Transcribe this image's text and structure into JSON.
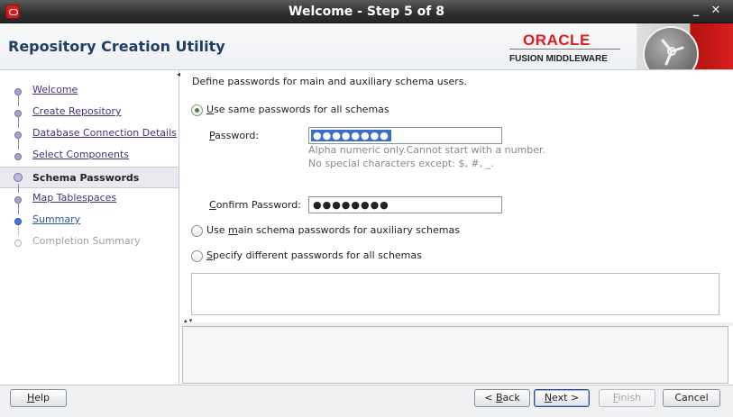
{
  "window": {
    "title": "Welcome - Step 5 of 8",
    "minimize_glyph": "_",
    "close_glyph": "✕"
  },
  "header": {
    "app_title": "Repository Creation Utility",
    "brand_name": "ORACLE",
    "brand_sub": "FUSION MIDDLEWARE",
    "brand_color": "#e01d1d"
  },
  "sidebar": {
    "steps": [
      {
        "label": "Welcome",
        "state": "done"
      },
      {
        "label": "Create Repository",
        "state": "done"
      },
      {
        "label": "Database Connection Details",
        "state": "done"
      },
      {
        "label": "Select Components",
        "state": "done"
      },
      {
        "label": "Schema Passwords",
        "state": "active"
      },
      {
        "label": "Map Tablespaces",
        "state": "done"
      },
      {
        "label": "Summary",
        "state": "current"
      },
      {
        "label": "Completion Summary",
        "state": "disabled"
      }
    ]
  },
  "main": {
    "intro": "Define passwords for main and auxiliary schema users.",
    "option_same": "Use same passwords for all schemas",
    "option_main_aux": "Use main schema passwords for auxiliary schemas",
    "option_different": "Specify different passwords for all schemas",
    "selected_option": "same",
    "password_label": "Password:",
    "password_value": "●●●●●●●●",
    "hint_line1": "Alpha numeric only.Cannot start with a number.",
    "hint_line2": "No special characters except: $, #, _.",
    "confirm_label": "Confirm Password:",
    "confirm_value": "●●●●●●●●"
  },
  "footer": {
    "help": "Help",
    "back": "< Back",
    "next": "Next >",
    "finish": "Finish",
    "cancel": "Cancel"
  }
}
